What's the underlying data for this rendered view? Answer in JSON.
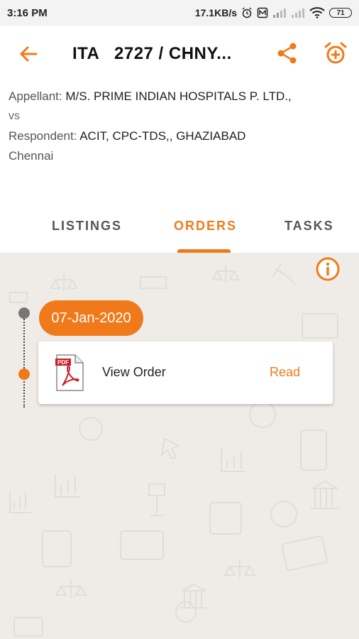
{
  "status_bar": {
    "time": "3:16 PM",
    "network_speed": "17.1KB/s",
    "battery": "71",
    "icons": [
      "alarm-icon",
      "data-saver-icon",
      "signal-icon",
      "signal-icon",
      "wifi-icon",
      "battery-icon"
    ]
  },
  "app_bar": {
    "title": "ITA   2727 / CHNY...",
    "icons": [
      "back-arrow-icon",
      "share-icon",
      "alarm-add-icon"
    ]
  },
  "case": {
    "appellant_label": "Appellant:",
    "appellant_value": "M/S. PRIME INDIAN HOSPITALS P. LTD.,",
    "vs": "vs",
    "respondent_label": "Respondent:",
    "respondent_value": "ACIT, CPC-TDS,, GHAZIABAD",
    "bench": "Chennai"
  },
  "tabs": [
    {
      "label": "LISTINGS",
      "active": false
    },
    {
      "label": "ORDERS",
      "active": true
    },
    {
      "label": "TASKS",
      "active": false
    }
  ],
  "orders": {
    "date": "07-Jan-2020",
    "item": {
      "label": "View Order",
      "action": "Read",
      "icon": "pdf-icon",
      "icon_text": "PDF"
    }
  },
  "colors": {
    "accent": "#f07a1a",
    "background": "#efece7",
    "status_bar": "#f3f3f3"
  }
}
